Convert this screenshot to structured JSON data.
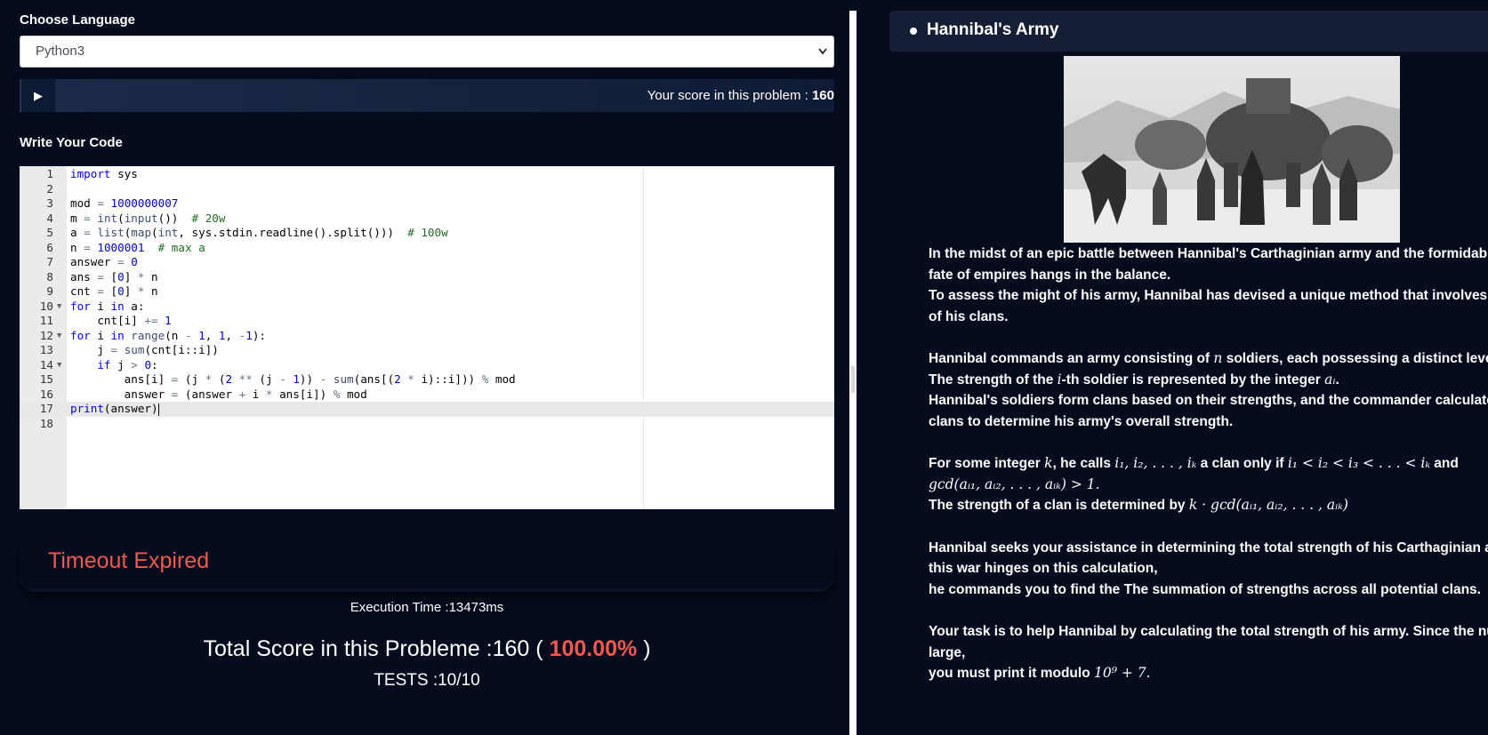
{
  "left": {
    "language_label": "Choose Language",
    "language_selected": "Python3",
    "run_icon": "play-icon",
    "score_label": "Your score in this problem :",
    "score_value": "160",
    "code_label": "Write Your Code",
    "code_lines": [
      "import sys",
      "",
      "mod = 1000000007",
      "m = int(input())  # 20w",
      "a = list(map(int, sys.stdin.readline().split()))  # 100w",
      "n = 1000001  # max a",
      "answer = 0",
      "ans = [0] * n",
      "cnt = [0] * n",
      "for i in a:",
      "    cnt[i] += 1",
      "for i in range(n - 1, 1, -1):",
      "    j = sum(cnt[i::i])",
      "    if j > 0:",
      "        ans[i] = (j * (2 ** (j - 1)) - sum(ans[(2 * i)::i])) % mod",
      "        answer = (answer + i * ans[i]) % mod",
      "print(answer)",
      ""
    ],
    "result_status": "Timeout Expired",
    "execution_time": "Execution Time :13473ms",
    "total_score_prefix": "Total Score in this Probleme :160 (",
    "total_score_percent": "100.00%",
    "total_score_suffix": ")",
    "tests": "TESTS :10/10",
    "colors": {
      "background": "#050c1e",
      "error": "#ef5a50"
    }
  },
  "right": {
    "title": "Hannibal's Army",
    "image_alt": "illustration-of-army-with-elephants",
    "p1_l1": "In the midst of an epic battle between Hannibal's Carthaginian army and the formidable Ror",
    "p1_l2": "fate of empires hangs in the balance.",
    "p1_l3": "To assess the might of his army, Hannibal has devised a unique method that involves evalua",
    "p1_l4": "of his clans.",
    "p2_l1a": "Hannibal commands an army consisting of ",
    "p2_l1m": "n",
    "p2_l1b": " soldiers, each possessing a distinct level of str",
    "p2_l2a": "The strength of the ",
    "p2_l2m": "i",
    "p2_l2b": "-th soldier is represented by the integer ",
    "p2_l2m2": "aᵢ",
    "p2_l2c": ".",
    "p2_l3": "Hannibal's soldiers form clans based on their strengths, and the commander calculates the",
    "p2_l4": "clans to determine his army's overall strength.",
    "p3_l1a": "For some integer ",
    "p3_l1m": "k",
    "p3_l1b": ", he calls ",
    "p3_l1m2": "i₁, i₂, . . . , iₖ",
    "p3_l1c": " a clan only if ",
    "p3_l1m3": "i₁ < i₂ < i₃ < . . . < iₖ",
    "p3_l1d": " and",
    "p3_l2m": "gcd(aᵢ₁, aᵢ₂, . . . , aᵢₖ) > 1.",
    "p3_l3a": "The strength of a clan is determined by ",
    "p3_l3m": "k · gcd(aᵢ₁, aᵢ₂, . . . , aᵢₖ)",
    "p4_l1": "Hannibal seeks your assistance in determining the total strength of his Carthaginian army. A",
    "p4_l2": "this war hinges on this calculation,",
    "p4_l3": "he commands you to find the The summation of strengths across all potential clans.",
    "p5_l1": "Your task is to help Hannibal by calculating the total strength of his army. Since the number",
    "p5_l2": "large,",
    "p5_l3a": "you must print it modulo ",
    "p5_l3m": "10⁹ + 7."
  }
}
